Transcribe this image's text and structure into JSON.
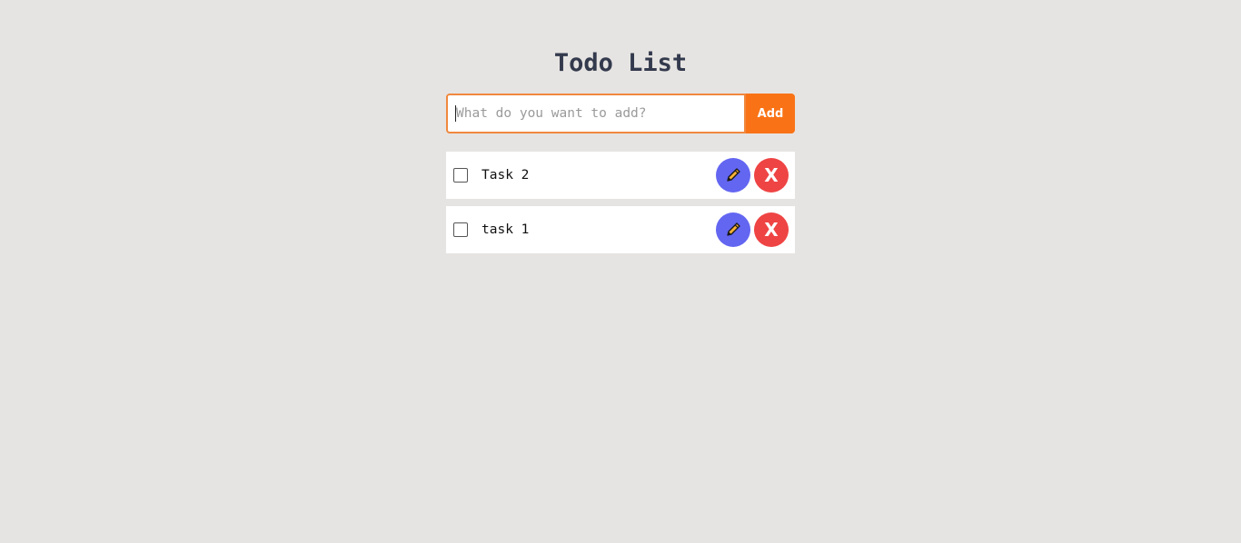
{
  "app": {
    "title": "Todo List"
  },
  "add_form": {
    "placeholder": "What do you want to add?",
    "value": "",
    "add_label": "Add"
  },
  "todos": [
    {
      "text": "Task 2",
      "checked": false,
      "edit_icon": "pencil-icon",
      "delete_label": "X"
    },
    {
      "text": "task 1",
      "checked": false,
      "edit_icon": "pencil-icon",
      "delete_label": "X"
    }
  ],
  "colors": {
    "background": "#e6e4e2",
    "accent": "#f97316",
    "input_border": "#f0883e",
    "edit": "#6366f1",
    "delete": "#ef4444",
    "pencil": "#f9b233",
    "title": "#333a4d"
  }
}
